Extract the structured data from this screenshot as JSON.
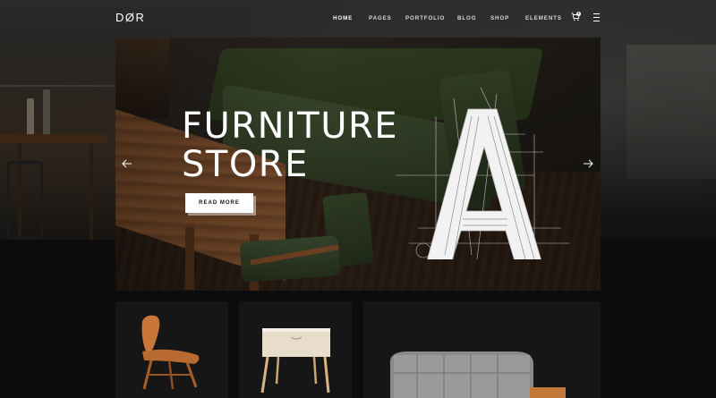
{
  "header": {
    "logo": "DØR",
    "nav": [
      {
        "label": "HOME",
        "active": true
      },
      {
        "label": "PAGES",
        "active": false
      },
      {
        "label": "PORTFOLIO",
        "active": false
      },
      {
        "label": "BLOG",
        "active": false
      },
      {
        "label": "SHOP",
        "active": false
      },
      {
        "label": "ELEMENTS",
        "active": false
      }
    ],
    "cart_count": "0",
    "icons": [
      "cart-icon",
      "menu-icon"
    ]
  },
  "hero": {
    "title_line1": "FURNITURE",
    "title_line2": "STORE",
    "button_label": "READ MORE",
    "decorative_letter": "A",
    "arrows": [
      "arrow-left-icon",
      "arrow-right-icon"
    ]
  },
  "products": [
    {
      "kind": "plywood-lounge-chair"
    },
    {
      "kind": "nightstand"
    },
    {
      "kind": "tufted-armchair"
    }
  ],
  "colors": {
    "background": "#0b0b0b",
    "tile": "#161616",
    "accent": "#ffffff"
  }
}
